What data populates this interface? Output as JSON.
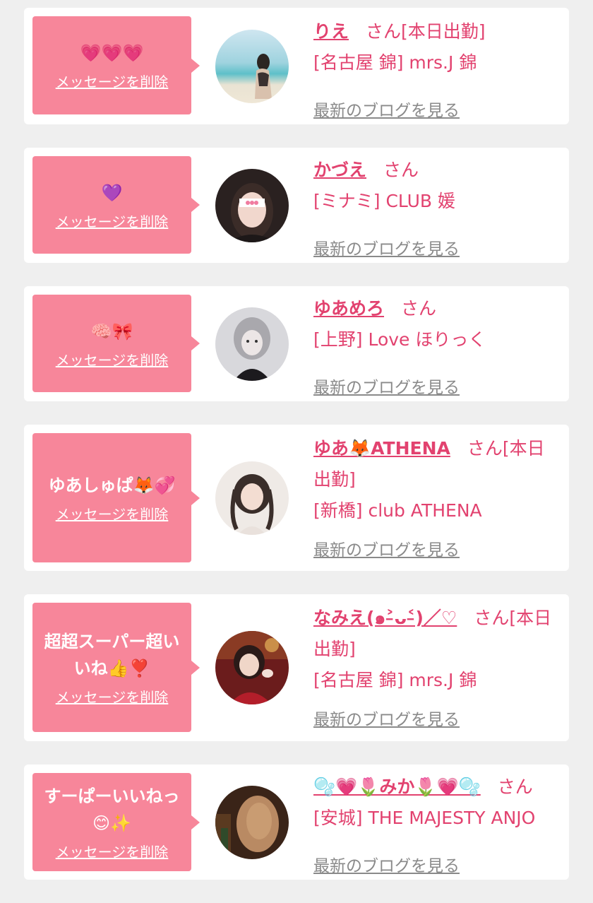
{
  "cards": [
    {
      "message": "💗💗💗",
      "delete_label": "メッセージを削除",
      "name": "りえ",
      "honorific": "さん[本日出勤]",
      "shop": "[名古屋 錦] mrs.J 錦",
      "blog_link": "最新のブログを見る",
      "avatar_icon": "beach-photo"
    },
    {
      "message": "💜",
      "delete_label": "メッセージを削除",
      "name": "かづえ",
      "honorific": "さん",
      "shop": "[ミナミ] CLUB 媛",
      "blog_link": "最新のブログを見る",
      "avatar_icon": "portrait-photo"
    },
    {
      "message": "🧠🎀",
      "delete_label": "メッセージを削除",
      "name": "ゆあめろ",
      "honorific": "さん",
      "shop": "[上野] Love ほりっく",
      "blog_link": "最新のブログを見る",
      "avatar_icon": "portrait-photo"
    },
    {
      "message": "ゆあしゅぱ🦊💞",
      "delete_label": "メッセージを削除",
      "name": "ゆあ🦊ATHENA",
      "honorific": "さん[本日出勤]",
      "shop": "[新橋] club ATHENA",
      "blog_link": "最新のブログを見る",
      "avatar_icon": "portrait-photo"
    },
    {
      "message": "超超スーパー超いいね👍❣️",
      "delete_label": "メッセージを削除",
      "name": "なみえ(๑˃̵ᴗ˂̵)／♡",
      "honorific": "さん[本日出勤]",
      "shop": "[名古屋 錦] mrs.J 錦",
      "blog_link": "最新のブログを見る",
      "avatar_icon": "portrait-photo"
    },
    {
      "message": "すーぱーいいねっ😊✨",
      "delete_label": "メッセージを削除",
      "name": "🫧💗🌷みか🌷💗🫧",
      "honorific": "さん",
      "shop": "[安城] THE MAJESTY ANJO",
      "blog_link": "最新のブログを見る",
      "avatar_icon": "portrait-photo"
    }
  ],
  "colors": {
    "accent": "#e2426f",
    "bubble": "#f7869a",
    "background": "#efefef",
    "link_gray": "#8a8a8a"
  }
}
